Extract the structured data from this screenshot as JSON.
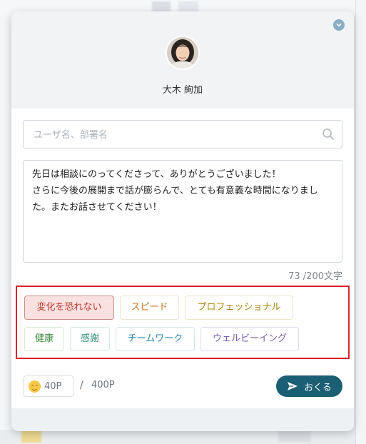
{
  "profile": {
    "name": "大木 絢加"
  },
  "search": {
    "placeholder": "ユーザ名、部署名",
    "value": ""
  },
  "message": {
    "text": "先日は相談にのってくださって、ありがとうございました！\nさらに今後の展開まで話が膨らんで、とても有意義な時間になりました。またお話させてください！",
    "char_count": "73 /200文字"
  },
  "tags": [
    {
      "label": "変化を恐れない",
      "selected": true,
      "color": "#c0392b"
    },
    {
      "label": "スピード",
      "selected": false,
      "color": "#c97a1e"
    },
    {
      "label": "プロフェッショナル",
      "selected": false,
      "color": "#a88a10"
    },
    {
      "label": "健康",
      "selected": false,
      "color": "#3e8a3e"
    },
    {
      "label": "感謝",
      "selected": false,
      "color": "#2f8f7a"
    },
    {
      "label": "チームワーク",
      "selected": false,
      "color": "#2a87b8"
    },
    {
      "label": "ウェルビーイング",
      "selected": false,
      "color": "#7a5cb0"
    }
  ],
  "points": {
    "current": "40P",
    "separator": "/",
    "max": "400P"
  },
  "send_button": {
    "label": "おくる"
  },
  "colors": {
    "accent": "#1a5f73",
    "highlight_border": "#d5242d",
    "header_bg": "#f1f3f5"
  },
  "icons": {
    "collapse": "chevron-down-icon",
    "search": "search-icon",
    "send": "paper-plane-icon",
    "points": "smile-emoji-icon"
  }
}
